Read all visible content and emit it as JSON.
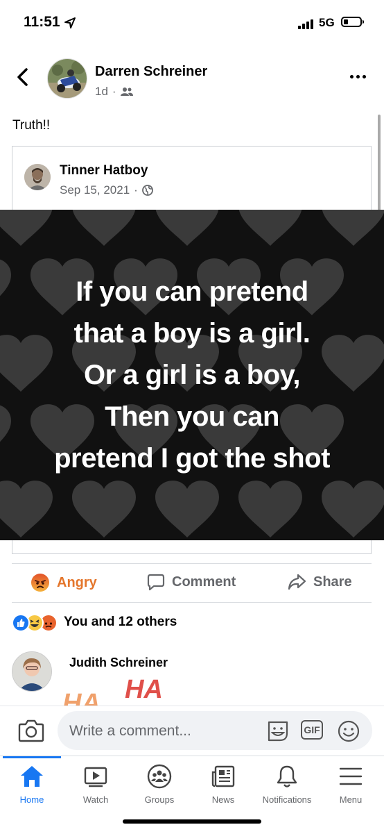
{
  "status_bar": {
    "time": "11:51",
    "network": "5G"
  },
  "post": {
    "author": "Darren Schreiner",
    "time": "1d",
    "text": "Truth!!",
    "shared": {
      "author": "Tinner Hatboy",
      "date": "Sep 15, 2021",
      "meme_lines": [
        "If you can pretend",
        "that a boy is a girl.",
        "Or a girl is a boy,",
        "Then you can",
        "pretend I got the shot"
      ]
    },
    "actions": {
      "angry": "Angry",
      "comment": "Comment",
      "share": "Share"
    },
    "reactions_text": "You and 12 others"
  },
  "comment": {
    "author": "Judith Schreiner",
    "sticker_text": "HA"
  },
  "comment_bar": {
    "placeholder": "Write a comment...",
    "gif_label": "GIF"
  },
  "nav": {
    "items": [
      {
        "label": "Home"
      },
      {
        "label": "Watch"
      },
      {
        "label": "Groups"
      },
      {
        "label": "News"
      },
      {
        "label": "Notifications"
      },
      {
        "label": "Menu"
      }
    ]
  },
  "colors": {
    "accent": "#1877f2",
    "angry": "#e4762c"
  }
}
